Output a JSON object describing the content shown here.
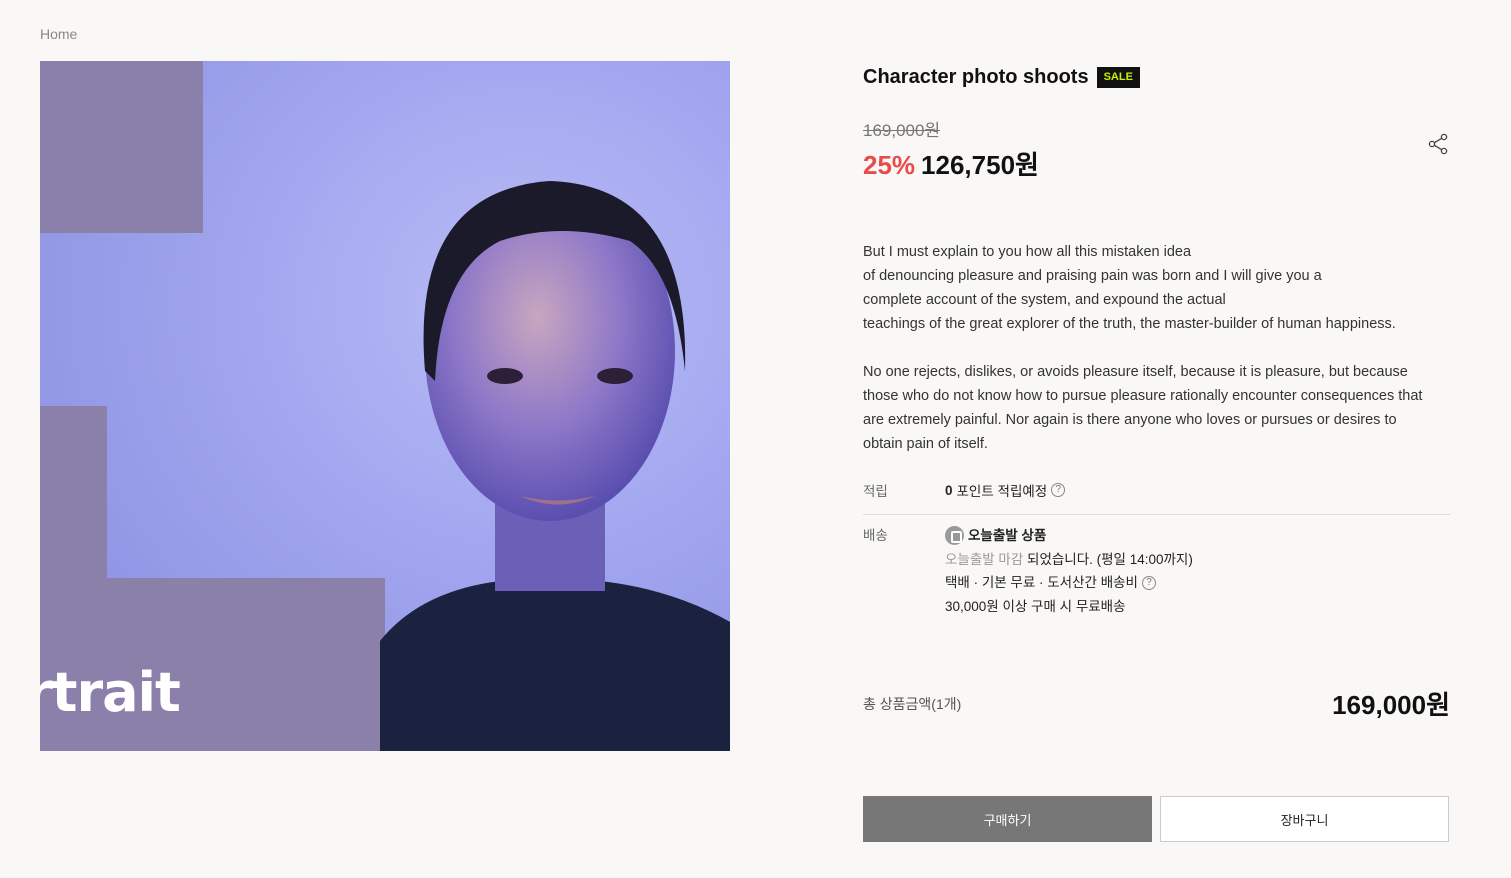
{
  "breadcrumb": {
    "home": "Home"
  },
  "hero": {
    "brand_word": "rtrait",
    "image_icon": "portrait-photo"
  },
  "product": {
    "title": "Character photo shoots",
    "badge": "SALE",
    "original_price": "169,000원",
    "discount": "25%",
    "sale_price": "126,750원",
    "share_icon": "share-icon"
  },
  "description": {
    "p1": [
      "But I must explain to you how all this mistaken idea",
      "of denouncing pleasure and praising pain was born and I will give you a",
      "complete account of the system, and expound the actual",
      "teachings of the great explorer of the truth, the master-builder of human happiness."
    ],
    "p2": [
      "No one rejects, dislikes, or avoids pleasure itself, because it is pleasure, but because",
      "those who do not know how to pursue pleasure rationally encounter consequences that",
      "are extremely painful. Nor again is there anyone who loves or pursues or desires to",
      "obtain pain of itself."
    ]
  },
  "points": {
    "label": "적립",
    "value_bold": "0",
    "value_text": "포인트 적립예정"
  },
  "shipping": {
    "label": "배송",
    "title": "오늘출발 상품",
    "line1_muted": "오늘출발 마감",
    "line1_rest": " 되었습니다. (평일 14:00까지)",
    "line2": "택배 · 기본 무료 · 도서산간 배송비",
    "line3": "30,000원 이상 구매 시 무료배송"
  },
  "total": {
    "label": "총 상품금액(1개)",
    "price": "169,000원"
  },
  "actions": {
    "buy": "구매하기",
    "cart": "장바구니"
  },
  "colors": {
    "sale_badge_text": "#c6f000",
    "discount": "#e94b4b",
    "buy_button": "#777777"
  }
}
